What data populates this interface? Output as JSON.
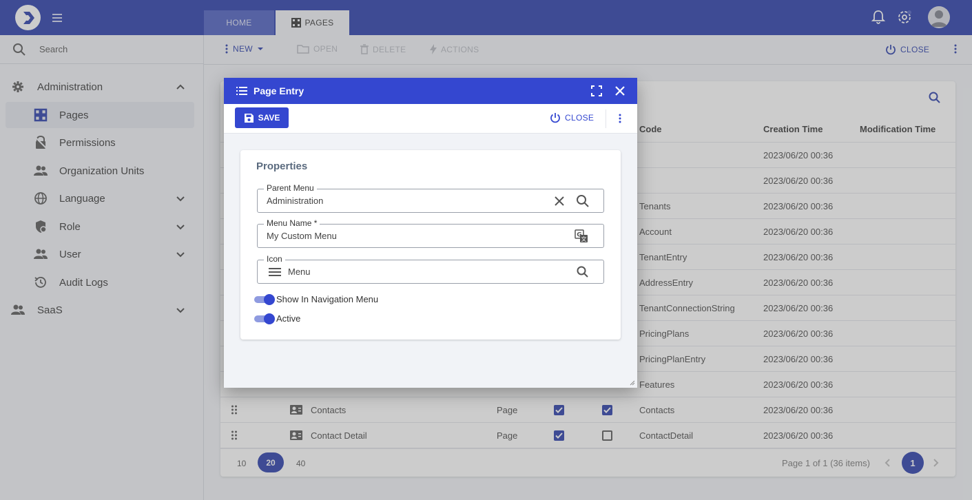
{
  "topbar": {
    "tabs": [
      {
        "label": "HOME",
        "icon": "none"
      },
      {
        "label": "PAGES",
        "icon": "pages-icon"
      }
    ],
    "colors": {
      "primary": "#253aa9"
    }
  },
  "sidebar": {
    "search_placeholder": "Search",
    "items": [
      {
        "label": "Administration",
        "icon": "gear-icon",
        "expanded": true
      },
      {
        "label": "Pages",
        "icon": "pages-icon",
        "active": true
      },
      {
        "label": "Permissions",
        "icon": "lock-icon"
      },
      {
        "label": "Organization Units",
        "icon": "people-icon"
      },
      {
        "label": "Language",
        "icon": "globe-icon"
      },
      {
        "label": "Role",
        "icon": "role-icon"
      },
      {
        "label": "User",
        "icon": "people-icon"
      },
      {
        "label": "Audit Logs",
        "icon": "history-icon"
      },
      {
        "label": "SaaS",
        "icon": "people-icon"
      }
    ]
  },
  "toolbar": {
    "new_label": "NEW",
    "open_label": "OPEN",
    "delete_label": "DELETE",
    "actions_label": "ACTIONS",
    "close_label": "CLOSE"
  },
  "grid": {
    "columns": {
      "code": "Code",
      "creation": "Creation Time",
      "modification": "Modification Time"
    },
    "rows": [
      {
        "name": "",
        "type": "",
        "code": "",
        "created": "2023/06/20 00:36"
      },
      {
        "name": "",
        "type": "",
        "code": "",
        "created": "2023/06/20 00:36"
      },
      {
        "name": "",
        "type": "",
        "code": "Tenants",
        "created": "2023/06/20 00:36"
      },
      {
        "name": "",
        "type": "",
        "code": "Account",
        "created": "2023/06/20 00:36"
      },
      {
        "name": "",
        "type": "",
        "code": "TenantEntry",
        "created": "2023/06/20 00:36"
      },
      {
        "name": "",
        "type": "",
        "code": "AddressEntry",
        "created": "2023/06/20 00:36"
      },
      {
        "name": "",
        "type": "",
        "code": "TenantConnectionString",
        "created": "2023/06/20 00:36"
      },
      {
        "name": "",
        "type": "",
        "code": "PricingPlans",
        "created": "2023/06/20 00:36"
      },
      {
        "name": "",
        "type": "",
        "code": "PricingPlanEntry",
        "created": "2023/06/20 00:36"
      },
      {
        "name": "",
        "type": "",
        "code": "Features",
        "created": "2023/06/20 00:36"
      },
      {
        "name": "Contacts",
        "type": "Page",
        "code": "Contacts",
        "created": "2023/06/20 00:36",
        "check1": true,
        "check2": true
      },
      {
        "name": "Contact Detail",
        "type": "Page",
        "code": "ContactDetail",
        "created": "2023/06/20 00:36",
        "check1": true,
        "check2": false
      }
    ],
    "page_sizes": [
      "10",
      "20",
      "40"
    ],
    "active_page_size": "20",
    "page_info": "Page 1 of 1 (36 items)",
    "current_page": "1"
  },
  "modal": {
    "title": "Page Entry",
    "save_label": "SAVE",
    "close_label": "CLOSE",
    "section_title": "Properties",
    "fields": {
      "parent_menu": {
        "label": "Parent Menu",
        "value": "Administration"
      },
      "menu_name": {
        "label": "Menu Name *",
        "value": "My Custom Menu"
      },
      "icon": {
        "label": "Icon",
        "value": "Menu"
      }
    },
    "switches": {
      "show_in_nav": {
        "label": "Show In Navigation Menu",
        "on": true
      },
      "active": {
        "label": "Active",
        "on": true
      }
    }
  }
}
